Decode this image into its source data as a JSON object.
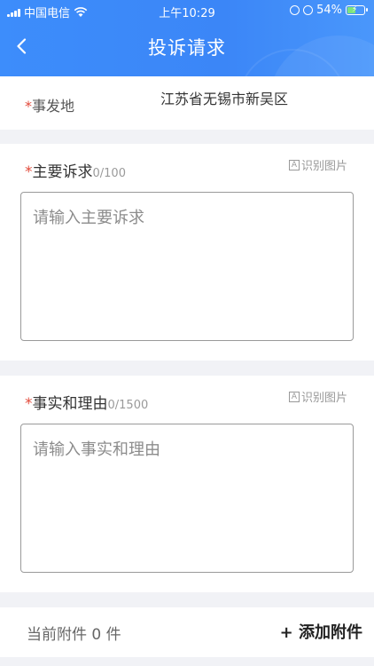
{
  "status_bar": {
    "carrier": "中国电信",
    "time": "上午10:29",
    "battery": "54%",
    "battery_level": 0.54
  },
  "nav": {
    "title": "投诉请求"
  },
  "location": {
    "required_mark": "*",
    "label": "事发地",
    "value": "江苏省无锡市新吴区"
  },
  "main_request": {
    "required_mark": "*",
    "label": "主要诉求",
    "counter": "0/100",
    "ocr_label": "识别图片",
    "ocr_icon_text": "A",
    "placeholder": "请输入主要诉求"
  },
  "facts": {
    "required_mark": "*",
    "label": "事实和理由",
    "counter": "0/1500",
    "ocr_label": "识别图片",
    "ocr_icon_text": "A",
    "placeholder": "请输入事实和理由"
  },
  "attachments": {
    "count_text": "当前附件 0 件",
    "add_label": "+ 添加附件"
  }
}
